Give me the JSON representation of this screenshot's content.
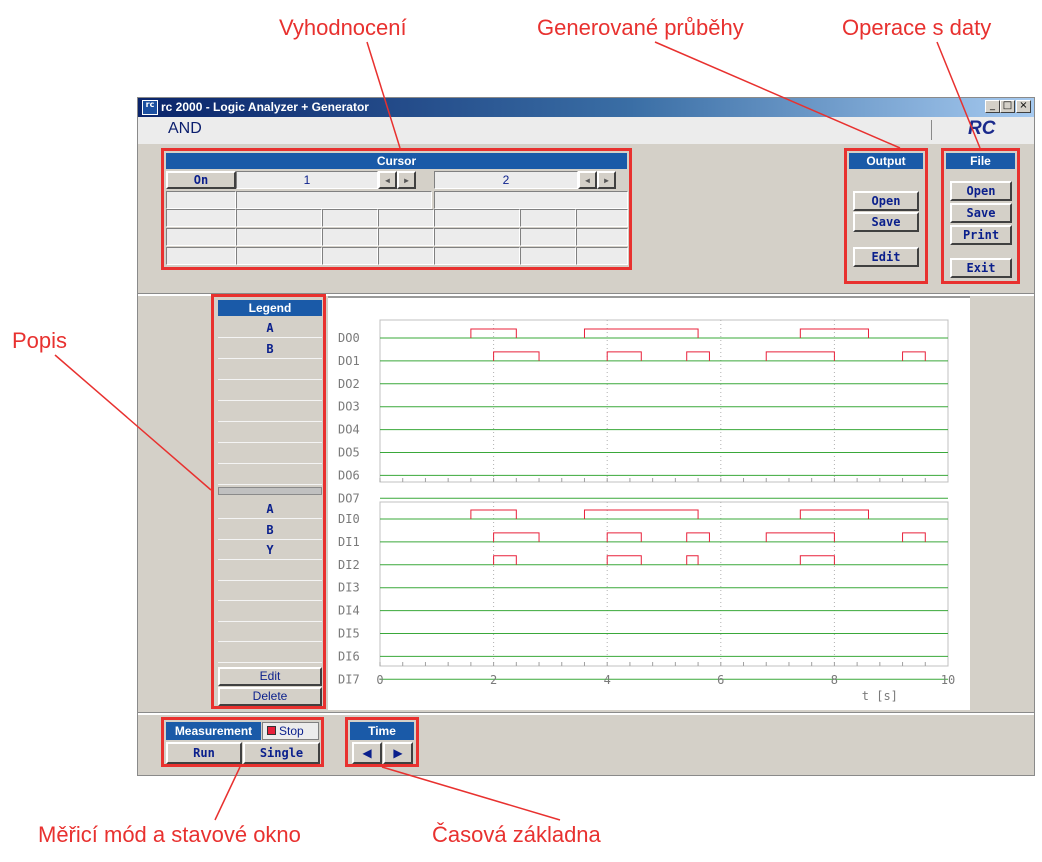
{
  "callouts": {
    "vyhodnoceni": "Vyhodnocení",
    "generovane": "Generované průběhy",
    "operace": "Operace s daty",
    "popis": "Popis",
    "merici": "Měřicí mód a stavové okno",
    "casova": "Časová základna"
  },
  "window": {
    "title": "rc 2000 - Logic Analyzer + Generator",
    "icon_text": "rc",
    "minimize": "_",
    "maximize": "□",
    "close": "×",
    "document_name": "AND",
    "logo": "RC"
  },
  "cursor": {
    "header": "Cursor",
    "on_button": "On",
    "cursor1": "1",
    "cursor2": "2",
    "arrow_left": "◂",
    "arrow_right": "▸"
  },
  "output": {
    "header": "Output",
    "open": "Open",
    "save": "Save",
    "edit": "Edit"
  },
  "file": {
    "header": "File",
    "open": "Open",
    "save": "Save",
    "print": "Print",
    "exit": "Exit"
  },
  "legend": {
    "header": "Legend",
    "top_rows": [
      "A",
      "B",
      "",
      "",
      "",
      "",
      "",
      ""
    ],
    "bottom_rows": [
      "A",
      "B",
      "Y",
      "",
      "",
      "",
      "",
      ""
    ],
    "edit": "Edit",
    "delete": "Delete"
  },
  "measurement": {
    "header": "Measurement",
    "status": "Stop",
    "run": "Run",
    "single": "Single"
  },
  "time": {
    "header": "Time",
    "left": "◀",
    "right": "▶"
  },
  "colors": {
    "accent": "#1a5aa8",
    "callout": "#e8312f",
    "signal_low": "#3aa83a",
    "signal_high": "#e8203a"
  },
  "chart_data": {
    "type": "line",
    "x_ticks": [
      "0",
      "2",
      "4",
      "6",
      "8",
      "10"
    ],
    "xlabel": "t [s]",
    "xlim": [
      0,
      10
    ],
    "outputs": [
      {
        "name": "DO0",
        "high": [
          [
            1.6,
            2.4
          ],
          [
            3.6,
            5.6
          ],
          [
            7.4,
            8.6
          ]
        ]
      },
      {
        "name": "DO1",
        "high": [
          [
            2.0,
            2.8
          ],
          [
            4.0,
            4.6
          ],
          [
            5.4,
            5.8
          ],
          [
            6.8,
            8.0
          ],
          [
            9.2,
            9.6
          ]
        ]
      },
      {
        "name": "DO2",
        "high": []
      },
      {
        "name": "DO3",
        "high": []
      },
      {
        "name": "DO4",
        "high": []
      },
      {
        "name": "DO5",
        "high": []
      },
      {
        "name": "DO6",
        "high": []
      },
      {
        "name": "DO7",
        "high": []
      }
    ],
    "inputs": [
      {
        "name": "DI0",
        "high": [
          [
            1.6,
            2.4
          ],
          [
            3.6,
            5.6
          ],
          [
            7.4,
            8.6
          ]
        ]
      },
      {
        "name": "DI1",
        "high": [
          [
            2.0,
            2.8
          ],
          [
            4.0,
            4.6
          ],
          [
            5.4,
            5.8
          ],
          [
            6.8,
            8.0
          ],
          [
            9.2,
            9.6
          ]
        ]
      },
      {
        "name": "DI2",
        "high": [
          [
            2.0,
            2.4
          ],
          [
            4.0,
            4.6
          ],
          [
            5.4,
            5.6
          ],
          [
            7.4,
            8.0
          ]
        ]
      },
      {
        "name": "DI3",
        "high": []
      },
      {
        "name": "DI4",
        "high": []
      },
      {
        "name": "DI5",
        "high": []
      },
      {
        "name": "DI6",
        "high": []
      },
      {
        "name": "DI7",
        "high": []
      }
    ]
  }
}
